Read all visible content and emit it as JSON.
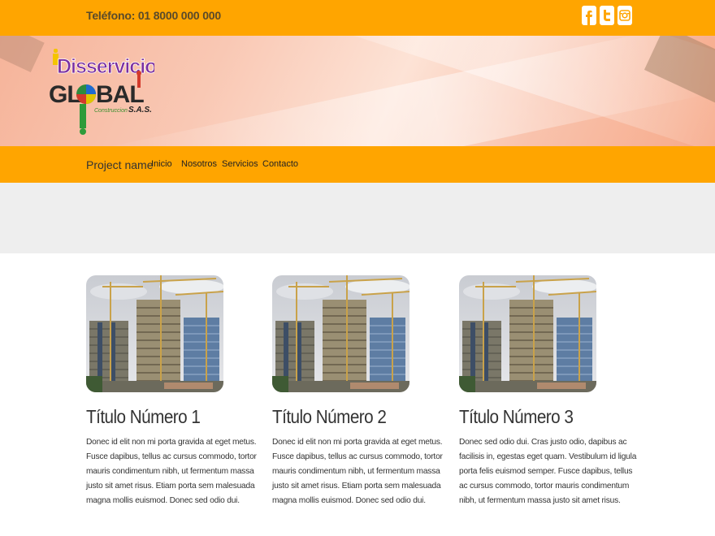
{
  "topbar": {
    "phone": "Teléfono: 01 8000 000 000",
    "social": [
      {
        "icon": "facebook-icon"
      },
      {
        "icon": "twitter-icon"
      },
      {
        "icon": "instagram-icon"
      }
    ]
  },
  "logo": {
    "line1": "Disservicios",
    "line2": "GLOBAL",
    "line3": "Construccion",
    "line4": "S.A.S."
  },
  "navbar": {
    "brand": "Project name",
    "links": [
      "Inicio",
      "Nosotros",
      "Servicios",
      "Contacto"
    ]
  },
  "cards": [
    {
      "title": "Título Número 1",
      "text": "Donec id elit non mi porta gravida at eget metus. Fusce dapibus, tellus ac cursus commodo, tortor mauris condimentum nibh, ut fermentum massa justo sit amet risus. Etiam porta sem malesuada magna mollis euismod. Donec sed odio dui."
    },
    {
      "title": "Título Número 2",
      "text": "Donec id elit non mi porta gravida at eget metus. Fusce dapibus, tellus ac cursus commodo, tortor mauris condimentum nibh, ut fermentum massa justo sit amet risus. Etiam porta sem malesuada magna mollis euismod. Donec sed odio dui."
    },
    {
      "title": "Título Número 3",
      "text": "Donec sed odio dui. Cras justo odio, dapibus ac facilisis in, egestas eget quam. Vestibulum id ligula porta felis euismod semper. Fusce dapibus, tellus ac cursus commodo, tortor mauris condimentum nibh, ut fermentum massa justo sit amet risus."
    }
  ],
  "colors": {
    "bar": "#ffa500",
    "jumbotron": "#eeeeee"
  }
}
